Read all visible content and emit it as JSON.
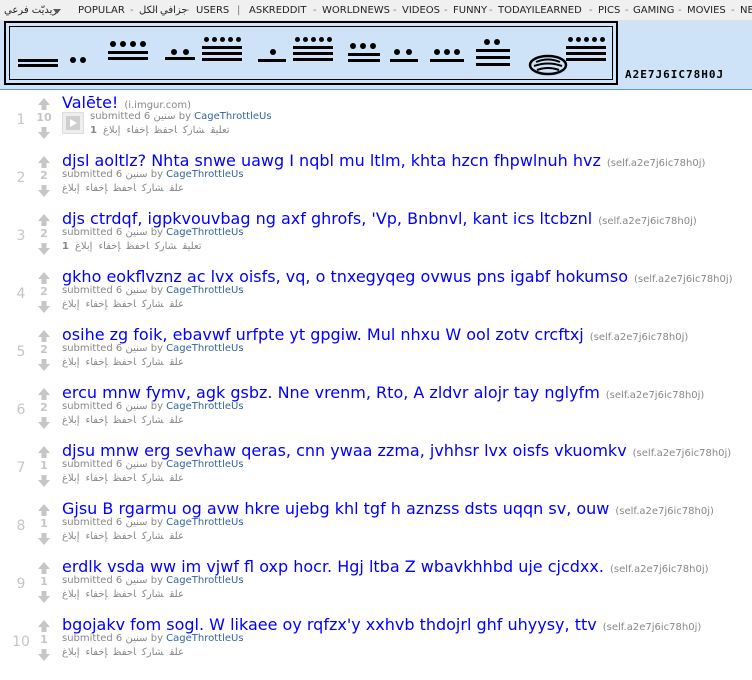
{
  "top_bar": {
    "items": [
      "ريديّت فرعي",
      "POPULAR",
      "-",
      "الكل",
      "-",
      "جزافي",
      "-",
      "USERS",
      "|",
      "ASKREDDIT",
      "-",
      "WORLDNEWS",
      "-",
      "VIDEOS",
      "-",
      "FUNNY",
      "-",
      "TODAYILEARNED",
      "-",
      "PICS",
      "-",
      "GAMING",
      "-",
      "MOVIES",
      "-",
      "NE"
    ]
  },
  "header": {
    "subreddit_name": "A2E7J6IC78H0J",
    "logo_icon": "cipher-glyph-banner-icon"
  },
  "links": [
    {
      "rank": "1",
      "score": "10",
      "title": "Valēte!",
      "domain": "(i.imgur.com)",
      "submitted": "submitted 6",
      "age": "سنين",
      "by": "by",
      "author": "CageThrottleUs",
      "comments": "تعليق",
      "comment_count": "1",
      "share": "شارك",
      "save": "احفظ",
      "hide": "إخفاء",
      "report": "إبلاغ",
      "has_thumb": true
    },
    {
      "rank": "2",
      "score": "2",
      "title": "djsl aoltlz? Nhta snwe uawg I nqbl mu ltlm, khta hzcn fhpwlnuh hvz",
      "domain": "(self.a2e7j6ic78h0j)",
      "submitted": "submitted 6",
      "age": "سنين",
      "by": "by",
      "author": "CageThrottleUs",
      "comments": "علق",
      "comment_count": "",
      "share": "شارك",
      "save": "احفظ",
      "hide": "إخفاء",
      "report": "إبلاغ",
      "has_thumb": false
    },
    {
      "rank": "3",
      "score": "2",
      "title": "djs ctrdqf, igpkvouvbag ng axf ghrofs, 'Vp, Bnbnvl, kant ics ltcbznl",
      "domain": "(self.a2e7j6ic78h0j)",
      "submitted": "submitted 6",
      "age": "سنين",
      "by": "by",
      "author": "CageThrottleUs",
      "comments": "تعليق",
      "comment_count": "1",
      "share": "شارك",
      "save": "احفظ",
      "hide": "إخفاء",
      "report": "إبلاغ",
      "has_thumb": false
    },
    {
      "rank": "4",
      "score": "2",
      "title": "gkho eokflvznz ac lvx oisfs, vq, o tnxegyqeg ovwus pns igabf hokumso",
      "domain": "(self.a2e7j6ic78h0j)",
      "submitted": "submitted 6",
      "age": "سنين",
      "by": "by",
      "author": "CageThrottleUs",
      "comments": "علق",
      "comment_count": "",
      "share": "شارك",
      "save": "احفظ",
      "hide": "إخفاء",
      "report": "إبلاغ",
      "has_thumb": false
    },
    {
      "rank": "5",
      "score": "2",
      "title": "osihe zg foik, ebavwf urfpte yt gpgiw. Mul nhxu W ool zotv crcftxj",
      "domain": "(self.a2e7j6ic78h0j)",
      "submitted": "submitted 6",
      "age": "سنين",
      "by": "by",
      "author": "CageThrottleUs",
      "comments": "علق",
      "comment_count": "",
      "share": "شارك",
      "save": "احفظ",
      "hide": "إخفاء",
      "report": "إبلاغ",
      "has_thumb": false
    },
    {
      "rank": "6",
      "score": "2",
      "title": "ercu mnw fymv, agk gsbz. Nne vrenm, Rto, A zldvr alojr tay nglyfm",
      "domain": "(self.a2e7j6ic78h0j)",
      "submitted": "submitted 6",
      "age": "سنين",
      "by": "by",
      "author": "CageThrottleUs",
      "comments": "علق",
      "comment_count": "",
      "share": "شارك",
      "save": "احفظ",
      "hide": "إخفاء",
      "report": "إبلاغ",
      "has_thumb": false
    },
    {
      "rank": "7",
      "score": "1",
      "title": "djsu mnw erg sevhaw qeras, cnn ywaa zzma, jvhhsr lvx oisfs vkuomkv",
      "domain": "(self.a2e7j6ic78h0j)",
      "submitted": "submitted 6",
      "age": "سنين",
      "by": "by",
      "author": "CageThrottleUs",
      "comments": "علق",
      "comment_count": "",
      "share": "شارك",
      "save": "احفظ",
      "hide": "إخفاء",
      "report": "إبلاغ",
      "has_thumb": false
    },
    {
      "rank": "8",
      "score": "1",
      "title": "Gjsu B rgarmu og avw hkre ujebg khl tgf h aznzss dsts uqqn sv, ouw",
      "domain": "(self.a2e7j6ic78h0j)",
      "submitted": "submitted 6",
      "age": "سنين",
      "by": "by",
      "author": "CageThrottleUs",
      "comments": "علق",
      "comment_count": "",
      "share": "شارك",
      "save": "احفظ",
      "hide": "إخفاء",
      "report": "إبلاغ",
      "has_thumb": false
    },
    {
      "rank": "9",
      "score": "1",
      "title": "erdlk vsda ww im vjwf fl oxp hocr. Hgj ltba Z wbavkhhbd uje cjcdxx.",
      "domain": "(self.a2e7j6ic78h0j)",
      "submitted": "submitted 6",
      "age": "سنين",
      "by": "by",
      "author": "CageThrottleUs",
      "comments": "علق",
      "comment_count": "",
      "share": "شارك",
      "save": "احفظ",
      "hide": "إخفاء",
      "report": "إبلاغ",
      "has_thumb": false
    },
    {
      "rank": "10",
      "score": "1",
      "title": "bgojakv fom sogl. W likaee oy rqfzx'y xxhvb thdojrl ghf uhyysy, ttv",
      "domain": "(self.a2e7j6ic78h0j)",
      "submitted": "submitted 6",
      "age": "سنين",
      "by": "by",
      "author": "CageThrottleUs",
      "comments": "علق",
      "comment_count": "",
      "share": "شارك",
      "save": "احفظ",
      "hide": "إخفاء",
      "report": "إبلاغ",
      "has_thumb": false
    }
  ]
}
